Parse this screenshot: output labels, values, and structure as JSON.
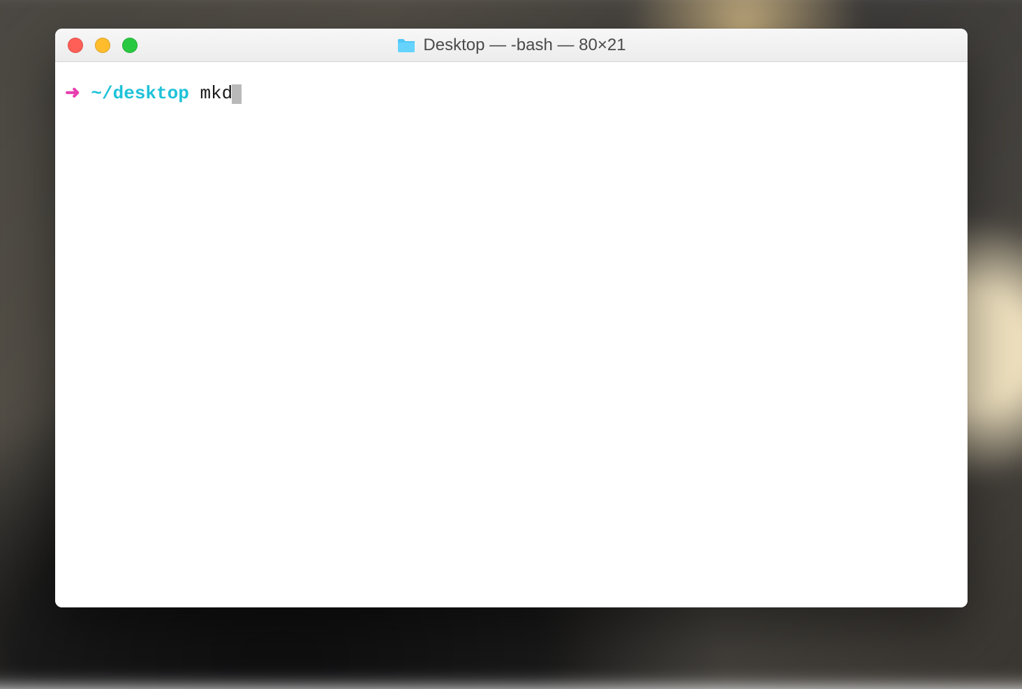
{
  "window": {
    "title": "Desktop — -bash — 80×21"
  },
  "prompt": {
    "arrow": "➜",
    "path": "~/desktop",
    "command": "mkd"
  },
  "colors": {
    "arrow": "#e83eaf",
    "path": "#1fc2d8",
    "titlebar_text": "#4b4b4b",
    "close": "#ff5f57",
    "minimize": "#ffbd2e",
    "zoom": "#28c940"
  }
}
